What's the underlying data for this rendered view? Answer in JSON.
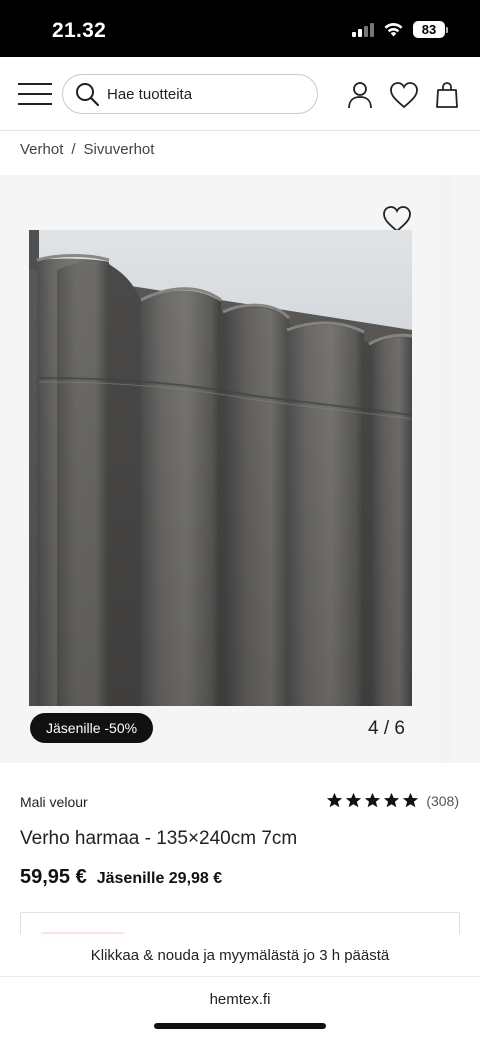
{
  "status_bar": {
    "time": "21.32",
    "battery": "83"
  },
  "header": {
    "search_placeholder": "Hae tuotteita"
  },
  "breadcrumb": {
    "items": [
      "Verhot",
      "Sivuverhot"
    ],
    "separator": "/"
  },
  "gallery": {
    "badge": "Jäsenille -50%",
    "counter": "4 / 6"
  },
  "product": {
    "brand": "Mali velour",
    "title": "Verho harmaa - 135×240cm 7cm",
    "price": "59,95 €",
    "member_price": "Jäsenille 29,98 €",
    "rating_value": 5,
    "rating_count": "(308)"
  },
  "toast": {
    "text": "Klikkaa & nouda ja myymälästä jo 3 h päästä"
  },
  "browser": {
    "url": "hemtex.fi"
  },
  "colors": {
    "badge_bg": "#111111",
    "accent_pink": "#f9d3dc",
    "fabric": "#6f6d69"
  }
}
